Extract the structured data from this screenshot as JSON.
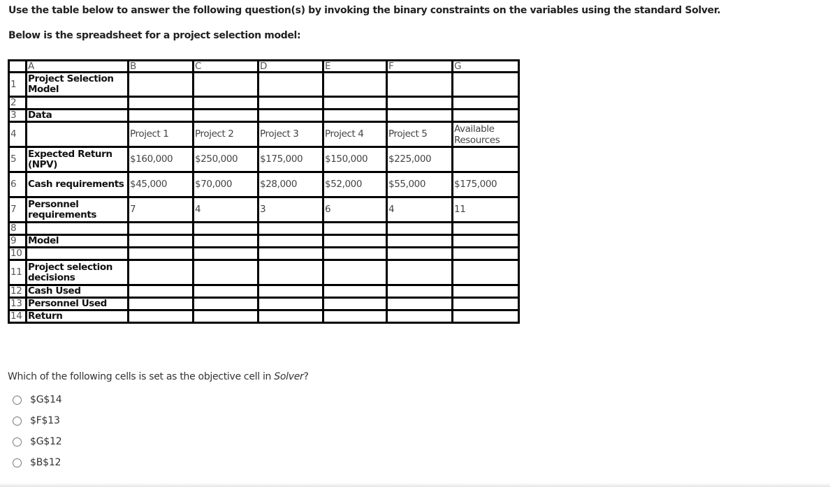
{
  "instructions": {
    "line1": "Use the table below to answer the following question(s) by invoking the binary constraints on the variables using the standard Solver.",
    "line2": "Below is the spreadsheet for a project selection model:"
  },
  "spreadsheet": {
    "column_headers": [
      "",
      "A",
      "B",
      "C",
      "D",
      "E",
      "F",
      "G"
    ],
    "rows": [
      {
        "num": "1",
        "label": "Project Selection Model",
        "cells": [
          "",
          "",
          "",
          "",
          "",
          ""
        ]
      },
      {
        "num": "2",
        "label": "",
        "cells": [
          "",
          "",
          "",
          "",
          "",
          ""
        ]
      },
      {
        "num": "3",
        "label": "Data",
        "cells": [
          "",
          "",
          "",
          "",
          "",
          ""
        ]
      },
      {
        "num": "4",
        "label": "",
        "cells": [
          "Project 1",
          "Project 2",
          "Project 3",
          "Project 4",
          "Project 5",
          "Available Resources"
        ]
      },
      {
        "num": "5",
        "label": "Expected Return (NPV)",
        "cells": [
          "$160,000",
          "$250,000",
          "$175,000",
          "$150,000",
          "$225,000",
          ""
        ]
      },
      {
        "num": "6",
        "label": "Cash requirements",
        "cells": [
          "$45,000",
          "$70,000",
          "$28,000",
          "$52,000",
          "$55,000",
          "$175,000"
        ]
      },
      {
        "num": "7",
        "label": "Personnel requirements",
        "cells": [
          "7",
          "4",
          "3",
          "6",
          "4",
          "11"
        ]
      },
      {
        "num": "8",
        "label": "",
        "cells": [
          "",
          "",
          "",
          "",
          "",
          ""
        ]
      },
      {
        "num": "9",
        "label": "Model",
        "cells": [
          "",
          "",
          "",
          "",
          "",
          ""
        ]
      },
      {
        "num": "10",
        "label": "",
        "cells": [
          "",
          "",
          "",
          "",
          "",
          ""
        ]
      },
      {
        "num": "11",
        "label": "Project selection decisions",
        "cells": [
          "",
          "",
          "",
          "",
          "",
          ""
        ]
      },
      {
        "num": "12",
        "label": "Cash Used",
        "cells": [
          "",
          "",
          "",
          "",
          "",
          ""
        ]
      },
      {
        "num": "13",
        "label": "Personnel Used",
        "cells": [
          "",
          "",
          "",
          "",
          "",
          ""
        ]
      },
      {
        "num": "14",
        "label": "Return",
        "cells": [
          "",
          "",
          "",
          "",
          "",
          ""
        ]
      }
    ]
  },
  "question": {
    "text_before": "Which of the following cells is set as the objective cell in ",
    "text_italic": "Solver",
    "text_after": "?",
    "options": [
      "$G$14",
      "$F$13",
      "$G$12",
      "$B$12"
    ]
  }
}
